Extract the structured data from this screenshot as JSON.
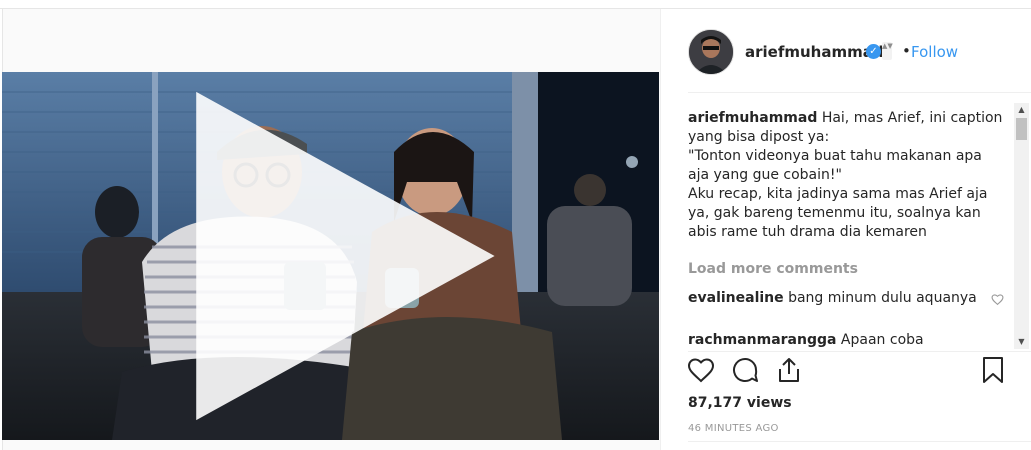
{
  "post": {
    "username": "ariefmuhammad",
    "follow_label": "Follow",
    "separator": "•",
    "verified_glyph": "✓",
    "caret_glyph": "▲▼",
    "caption_lines": [
      "Hai, mas Arief, ini caption",
      "yang bisa dipost ya:",
      "\"Tonton videonya buat tahu makanan apa",
      "aja yang gue cobain!\"",
      "Aku recap, kita jadinya sama mas Arief aja",
      "ya, gak bareng temenmu itu, soalnya kan",
      "abis rame tuh drama dia kemaren"
    ],
    "load_more_label": "Load more comments",
    "comments": [
      {
        "user": "evalinealine",
        "text": "bang minum dulu aquanya"
      },
      {
        "user": "rachmanmarangga",
        "text": "Apaan coba"
      }
    ],
    "views": "87,177 views",
    "time": "46 MINUTES AGO"
  },
  "icons": {
    "like": "heart-icon",
    "comment": "comment-icon",
    "share": "share-icon",
    "save": "bookmark-icon",
    "play": "play-icon",
    "verified": "verified-badge-icon"
  },
  "colors": {
    "link": "#3897f0",
    "text": "#262626",
    "muted": "#999999"
  }
}
